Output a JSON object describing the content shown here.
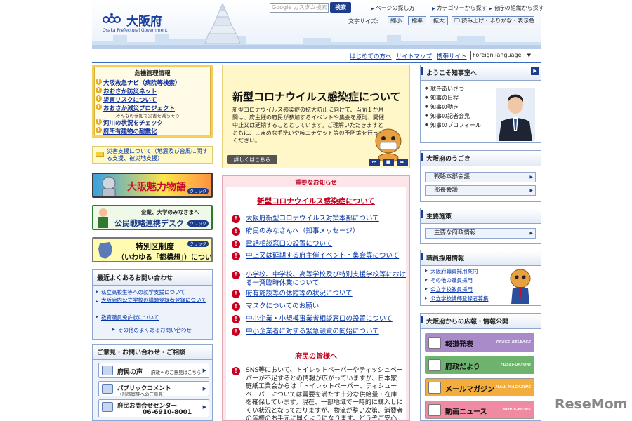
{
  "header": {
    "logo_text": "大阪府",
    "logo_en": "Osaka Prefectural Government",
    "search_placeholder": "Google カスタム検索",
    "search_button": "検索",
    "top_links": [
      "ページの探し方",
      "カテゴリーから探す",
      "府庁の組織から探す"
    ],
    "font_size_label": "文字サイズ:",
    "font_sizes": [
      "縮小",
      "標準",
      "拡大"
    ],
    "read_aloud": "読み上げ・ふりがな・表示色"
  },
  "nav": {
    "links": [
      "はじめての方へ",
      "サイトマップ",
      "携帯サイト"
    ],
    "foreign_language": "Foreign language"
  },
  "crisis": {
    "title": "危機管理情報",
    "items": [
      "大阪救急ナビ（病院等検索）",
      "おおさか防災ネット",
      "災害リスクについて",
      "おおさか減災プロジェクト",
      "河川の状況をチェック",
      "府所有建物の耐震化"
    ],
    "project_sub": "みんなの参加で災害を減らそう"
  },
  "disaster_support": "災害支援について（地震及び台風に関する支援、被災地支援）",
  "banners": {
    "miryoku": "大阪魅力物語",
    "koumin_top": "企業、大学のみなさまへ",
    "koumin": "公民戦略連携デスク",
    "tokubetsu_line1": "特別区制度",
    "tokubetsu_line2": "（いわゆる「都構想」）について",
    "click": "クリック"
  },
  "faq": {
    "title": "最近よくあるお問い合わせ",
    "items": [
      "私立高校生等への就学支援について",
      "大阪府内公立学校の講師登録者登録について",
      "教育職員免許状について"
    ],
    "more": "その他のよくあるお問い合わせ"
  },
  "contact": {
    "title": "ご意見・お問い合わせ・ご相談",
    "voice_label": "府民の声",
    "voice_sub": "府政へのご意見はこちら",
    "public_comment": "パブリックコメント",
    "public_comment_sub": "（計画案等へのご意見）",
    "center_label": "府民お問合せセンター",
    "center_phone": "06-6910-8001"
  },
  "featured": {
    "title": "新型コロナウイルス感染症について",
    "body": "新型コロナウイルス感染症の拡大防止に向けて、当面１か月間は、府主催の府民が参加するイベントや集会を原則、開催中止又は延期することとしています。ご理解いただきますとともに、こまめな手洗いや咳エチケット等の予防策を行ってください。",
    "detail_button": "詳しくはこちら",
    "controls": [
      "⏮",
      "■",
      "⏭"
    ]
  },
  "notice": {
    "header": "重要なお知らせ",
    "title": "新型コロナウイルス感染症について",
    "items": [
      "大阪府新型コロナウイルス対策本部について",
      "府民のみなさんへ（知事メッセージ）",
      "電話相談窓口の設置について",
      "中止又は延期する府主催イベント・集会等について",
      "小学校、中学校、高等学校及び特別支援学校等における一斉臨時休業について",
      "府有施設等の休館等の状況について",
      "マスクについてのお願い",
      "中小企業・小規模事業者相談窓口の設置について",
      "中小企業者に対する緊急融資の開始について"
    ],
    "citizens_head": "府民の皆様へ",
    "citizens_body": "SNS等において、トイレットペーパーやティッシュペーパーが不足するとの情報が広がっていますが、日本家庭紙工業会からは「トイレットペーパー、ティシューペーパーについては需要を満たす十分な供給量・在庫を確保しています。現在、一部地域で一時的に購入しにくい状況となっておりますが、物流が整い次第、消費者の皆様のお手元に届くようになります。どうぞご安心ください。」との発表がありました。府民の皆様には、"
  },
  "governor": {
    "title": "ようこそ知事室へ",
    "items": [
      "就任あいさつ",
      "知事の日程",
      "知事の動き",
      "知事の記者会見",
      "知事のプロフィール"
    ]
  },
  "movement": {
    "title": "大阪府のうごき",
    "items": [
      "戦略本部会議",
      "部長会議"
    ]
  },
  "policy": {
    "title": "主要施策",
    "items": [
      "主要な府政情報"
    ]
  },
  "recruit": {
    "title": "職員採用情報",
    "items": [
      "大阪府職員採用案内",
      "その他の職員採用",
      "公立学校教員採用",
      "公立学校講師登録者募集"
    ]
  },
  "pr": {
    "title": "大阪府からの広報・情報公開",
    "buttons": [
      {
        "label": "報道発表",
        "sub": "PRESS-RELEASE",
        "color": "#a98bc9"
      },
      {
        "label": "府政だより",
        "sub": "FUSEI-DAYORI",
        "color": "#6db36d"
      },
      {
        "label": "メールマガジン",
        "sub": "MAIL-MAGAZINE",
        "color": "#f2ad3d"
      },
      {
        "label": "動画ニュース",
        "sub": "MOVIE-NEWS",
        "color": "#f08aa2"
      }
    ]
  },
  "watermark": "ReseMom",
  "colors": {
    "accent": "#1e3c8c",
    "alert": "#c00020",
    "crisis": "#f5cf58"
  }
}
